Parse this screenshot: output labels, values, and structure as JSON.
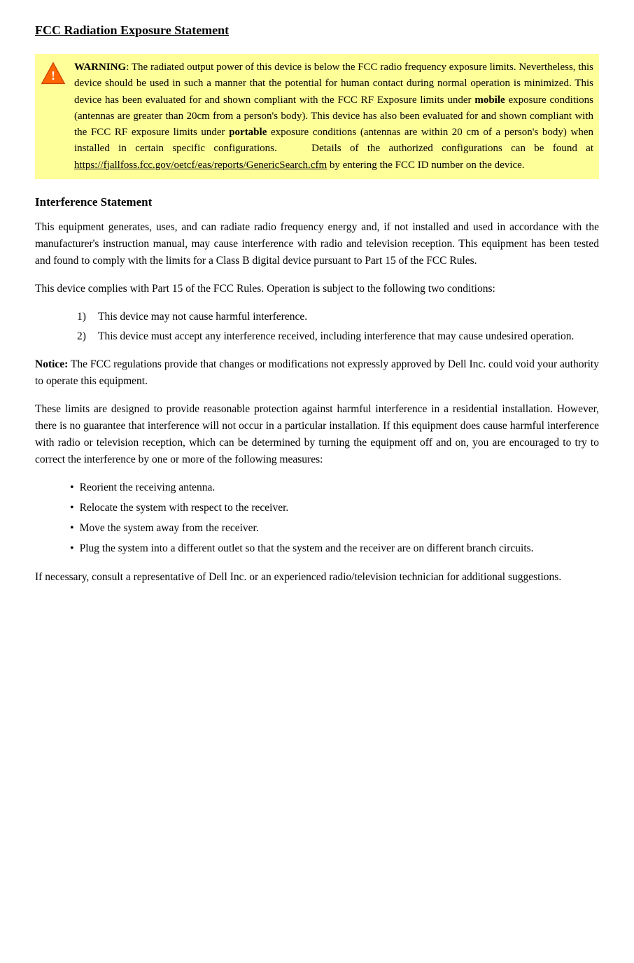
{
  "page": {
    "title": "FCC Radiation Exposure Statement",
    "warning": {
      "label": "WARNING",
      "text_parts": [
        ": The radiated output power of this device is below the FCC radio frequency exposure limits. Nevertheless, this device should be used in such a manner that the potential for human contact during normal operation is minimized. This device has been evaluated for and shown compliant with the FCC RF Exposure limits under ",
        "mobile",
        " exposure conditions (antennas are greater than 20cm from a person's body). This device has also been evaluated for and shown compliant with the FCC RF exposure limits under ",
        "portable",
        " exposure conditions (antennas are within 20 cm of a person's body) when installed in certain specific configurations.    Details of the authorized configurations can be found at ",
        "https://fjallfoss.fcc.gov/oetcf/eas/reports/GenericSearch.cfm",
        " by entering the FCC ID number on the device."
      ]
    },
    "interference_statement": {
      "heading": "Interference Statement",
      "paragraph1": "This equipment generates, uses, and can radiate radio frequency energy and, if not installed and used in accordance with the manufacturer's instruction manual, may cause interference with radio and television reception. This equipment has been tested and found to comply with the limits for a Class B digital device pursuant to Part 15 of the FCC Rules.",
      "paragraph2": "This device complies with Part 15 of the FCC Rules. Operation is subject to the following two conditions:",
      "numbered_items": [
        {
          "num": "1)",
          "text": "This device may not cause harmful interference."
        },
        {
          "num": "2)",
          "text": "This device must accept any interference received, including interference that may cause undesired operation."
        }
      ]
    },
    "notice": {
      "label": "Notice:",
      "text": " The FCC regulations provide that changes or modifications not expressly approved by Dell Inc. could void your authority to operate this equipment."
    },
    "limits_paragraph": "These limits are designed to provide reasonable protection against harmful interference in a residential installation. However, there is no guarantee that interference will not occur in a particular installation. If this equipment does cause harmful interference with radio or television reception, which can be determined by turning the equipment off and on, you are encouraged to try to correct the interference by one or more of the following measures:",
    "bullet_items": [
      "Reorient the receiving antenna.",
      "Relocate the system with respect to the receiver.",
      "Move the system away from the receiver.",
      "Plug the system into a different outlet so that the system and the receiver are on different branch circuits."
    ],
    "final_paragraph": "If necessary, consult a representative of Dell Inc. or an experienced radio/television technician for additional suggestions."
  }
}
